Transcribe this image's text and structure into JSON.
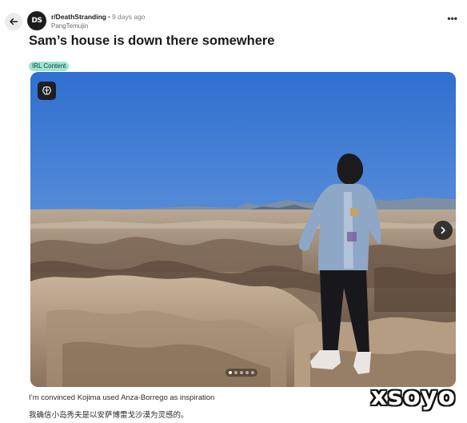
{
  "post": {
    "avatar_text": "DS",
    "subreddit": "r/DeathStranding",
    "separator": "•",
    "time_ago": "9 days ago",
    "author": "PangTemujin",
    "more_label": "•••",
    "title": "Sam’s house is down there somewhere",
    "flair": "IRL Content",
    "caption": "I’m convinced Kojima used Anza-Borrego as inspiration",
    "caption_cn": "我确信小岛秀夫是以安萨博雷戈沙漠为灵感的。"
  },
  "gallery": {
    "page_count": 5,
    "current_page": 1
  },
  "watermark": "xsoyo",
  "icons": {
    "back": "arrow-left-icon",
    "more": "more-horizontal-icon",
    "brain": "brain-icon",
    "next": "chevron-right-icon"
  },
  "colors": {
    "flair_bg": "#9fe5d5",
    "sky_top": "#2f6fd1",
    "sky_bottom": "#a9c7e6",
    "control_bg": "#1d1f24"
  }
}
